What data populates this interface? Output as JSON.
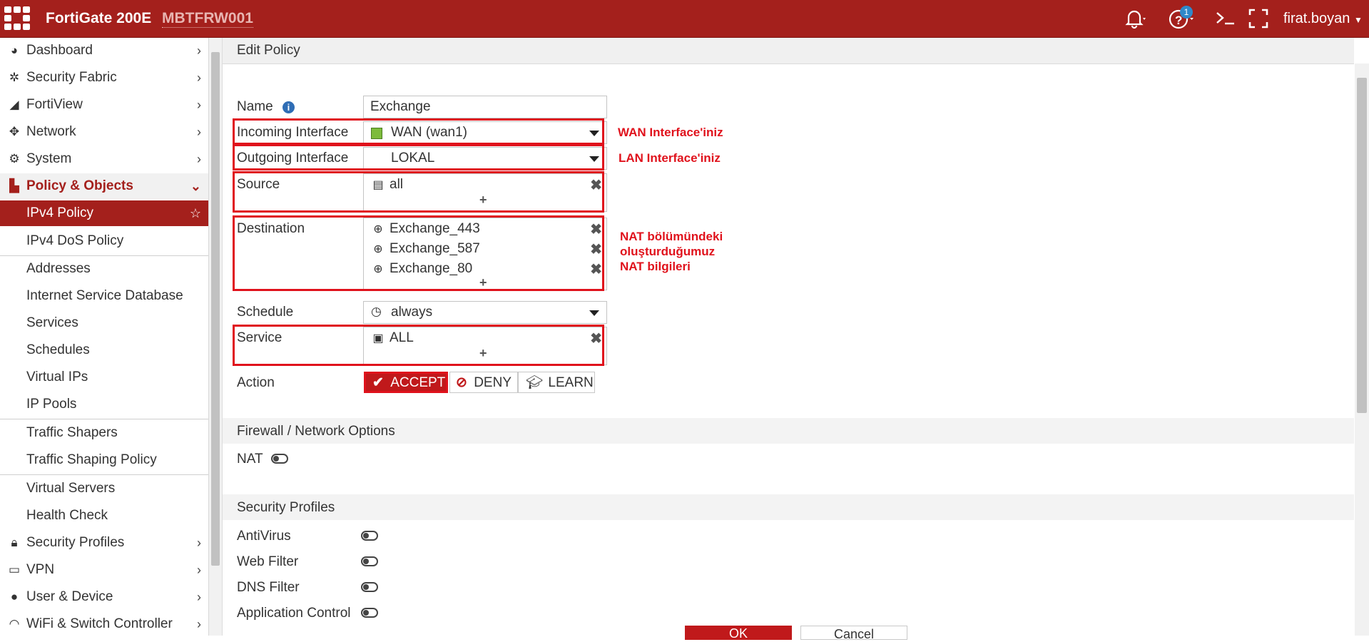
{
  "header": {
    "product": "FortiGate 200E",
    "hostname": "MBTFRW001",
    "notification_badge": "1",
    "user": "firat.boyan"
  },
  "sidebar": {
    "items": [
      {
        "label": "Dashboard",
        "icon": "dashboard-icon"
      },
      {
        "label": "Security Fabric",
        "icon": "security-fabric-icon"
      },
      {
        "label": "FortiView",
        "icon": "chart-icon"
      },
      {
        "label": "Network",
        "icon": "network-icon"
      },
      {
        "label": "System",
        "icon": "gear-icon"
      },
      {
        "label": "Policy & Objects",
        "icon": "policy-icon"
      },
      {
        "label": "IPv4 Policy"
      },
      {
        "label": "IPv4 DoS Policy"
      },
      {
        "label": "Addresses"
      },
      {
        "label": "Internet Service Database"
      },
      {
        "label": "Services"
      },
      {
        "label": "Schedules"
      },
      {
        "label": "Virtual IPs"
      },
      {
        "label": "IP Pools"
      },
      {
        "label": "Traffic Shapers"
      },
      {
        "label": "Traffic Shaping Policy"
      },
      {
        "label": "Virtual Servers"
      },
      {
        "label": "Health Check"
      },
      {
        "label": "Security Profiles",
        "icon": "lock-icon"
      },
      {
        "label": "VPN",
        "icon": "laptop-icon"
      },
      {
        "label": "User & Device",
        "icon": "user-icon"
      },
      {
        "label": "WiFi & Switch Controller",
        "icon": "wifi-icon"
      }
    ]
  },
  "page": {
    "title": "Edit Policy"
  },
  "form": {
    "name_label": "Name",
    "name_value": "Exchange",
    "incoming_label": "Incoming Interface",
    "incoming_value": "WAN (wan1)",
    "outgoing_label": "Outgoing Interface",
    "outgoing_value": "LOKAL",
    "source_label": "Source",
    "source_items": [
      "all"
    ],
    "destination_label": "Destination",
    "destination_items": [
      "Exchange_443",
      "Exchange_587",
      "Exchange_80"
    ],
    "schedule_label": "Schedule",
    "schedule_value": "always",
    "service_label": "Service",
    "service_items": [
      "ALL"
    ],
    "action_label": "Action",
    "action_accept": "ACCEPT",
    "action_deny": "DENY",
    "action_learn": "LEARN",
    "selected_action": "ACCEPT"
  },
  "annotations": {
    "wan": "WAN Interface'iniz",
    "lan": "LAN Interface'iniz",
    "nat_line1": "NAT bölümündeki",
    "nat_line2": "oluşturduğumuz",
    "nat_line3": "NAT bilgileri",
    "color": "#e0121c"
  },
  "firewall_options": {
    "title": "Firewall / Network Options",
    "nat_label": "NAT",
    "nat_enabled": false
  },
  "security_profiles": {
    "title": "Security Profiles",
    "items": [
      {
        "label": "AntiVirus",
        "enabled": false
      },
      {
        "label": "Web Filter",
        "enabled": false
      },
      {
        "label": "DNS Filter",
        "enabled": false
      },
      {
        "label": "Application Control",
        "enabled": false
      }
    ]
  },
  "footer": {
    "ok": "OK",
    "cancel": "Cancel"
  },
  "colors": {
    "brand": "#a4201c",
    "accent": "#2f88c9"
  }
}
